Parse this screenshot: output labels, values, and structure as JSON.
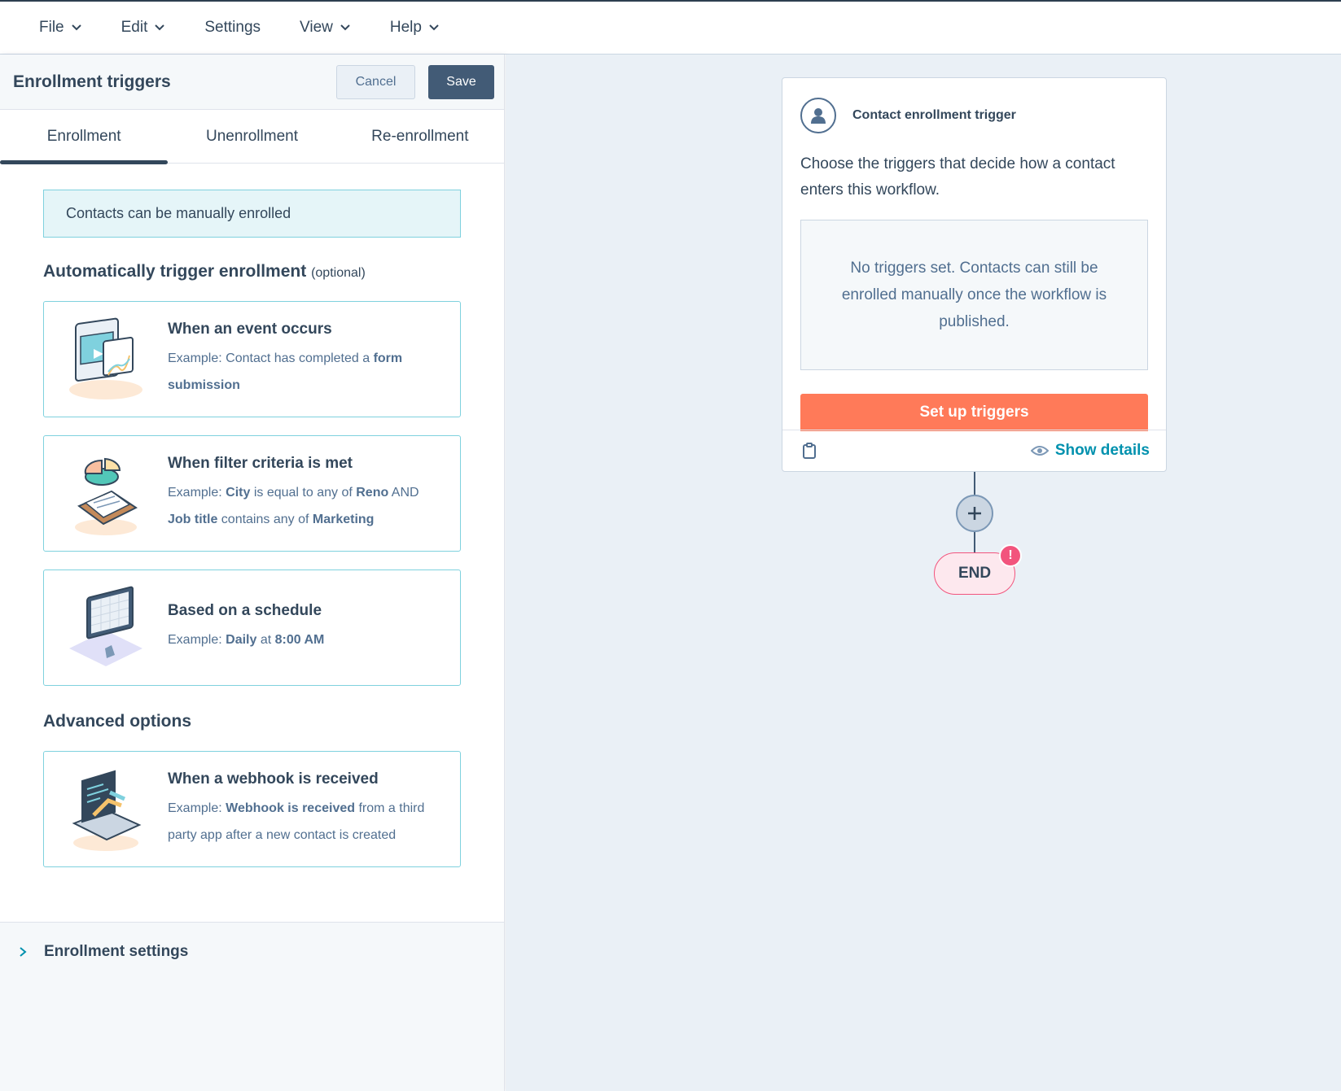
{
  "menubar": {
    "items": [
      {
        "label": "File",
        "dropdown": true
      },
      {
        "label": "Edit",
        "dropdown": true
      },
      {
        "label": "Settings",
        "dropdown": false
      },
      {
        "label": "View",
        "dropdown": true
      },
      {
        "label": "Help",
        "dropdown": true
      }
    ]
  },
  "panel": {
    "title": "Enrollment triggers",
    "cancel_label": "Cancel",
    "save_label": "Save",
    "tabs": [
      {
        "label": "Enrollment",
        "active": true
      },
      {
        "label": "Unenrollment",
        "active": false
      },
      {
        "label": "Re-enrollment",
        "active": false
      }
    ],
    "notice": "Contacts can be manually enrolled",
    "auto_title": "Automatically trigger enrollment",
    "auto_optional": "(optional)",
    "cards": [
      {
        "title": "When an event occurs",
        "desc_html": "Example: Contact has completed a <b>form submission</b>",
        "icon": "event-illustration"
      },
      {
        "title": "When filter criteria is met",
        "desc_html": "Example: <b>City</b> is equal to any of <b>Reno</b> AND <b>Job title</b> contains any of <b>Marketing</b>",
        "icon": "filter-illustration"
      },
      {
        "title": "Based on a schedule",
        "desc_html": "Example: <b>Daily</b> at <b>8:00 AM</b>",
        "icon": "schedule-illustration"
      }
    ],
    "advanced_title": "Advanced options",
    "advanced_cards": [
      {
        "title": "When a webhook is received",
        "desc_html": "Example: <b>Webhook is received</b> from a third party app after a new contact is created",
        "icon": "webhook-illustration"
      }
    ],
    "settings_label": "Enrollment settings"
  },
  "canvas": {
    "trigger_card": {
      "title": "Contact enrollment trigger",
      "description": "Choose the triggers that decide how a contact enters this workflow.",
      "empty_text": "No triggers set. Contacts can still be enrolled manually once the workflow is published.",
      "setup_label": "Set up triggers",
      "show_details_label": "Show details"
    },
    "end_label": "END",
    "alert_badge": "!"
  },
  "colors": {
    "accent_orange": "#ff7a59",
    "link_teal": "#0091ae",
    "navy": "#33475b",
    "save_button": "#425b76",
    "alert": "#f2547d"
  }
}
